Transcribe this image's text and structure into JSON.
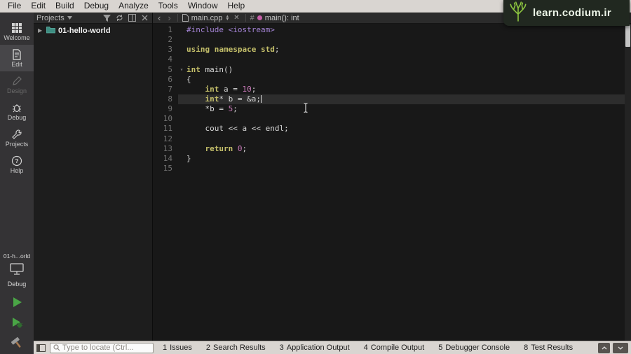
{
  "menu_bar": {
    "items": [
      "File",
      "Edit",
      "Build",
      "Debug",
      "Analyze",
      "Tools",
      "Window",
      "Help"
    ]
  },
  "watermark": {
    "text": "learn.codium.ir"
  },
  "mode_sidebar": {
    "items": [
      {
        "label": "Welcome"
      },
      {
        "label": "Edit",
        "active": true
      },
      {
        "label": "Design",
        "disabled": true
      },
      {
        "label": "Debug"
      },
      {
        "label": "Projects"
      },
      {
        "label": "Help"
      }
    ],
    "kit": {
      "project": "01-h...orld",
      "config": "Debug"
    }
  },
  "projects_panel": {
    "title": "Projects",
    "tree": [
      {
        "label": "01-hello-world"
      }
    ]
  },
  "editor": {
    "toolbar": {
      "filename": "main.cpp",
      "hash": "#",
      "symbol": "main(): int"
    },
    "code_lines": [
      {
        "n": 1,
        "t": [
          [
            "pp",
            "#include <iostream>"
          ]
        ]
      },
      {
        "n": 2,
        "t": []
      },
      {
        "n": 3,
        "t": [
          [
            "kw",
            "using"
          ],
          [
            "pl",
            " "
          ],
          [
            "kw",
            "namespace"
          ],
          [
            "pl",
            " "
          ],
          [
            "kw",
            "std"
          ],
          [
            "pl",
            ";"
          ]
        ]
      },
      {
        "n": 4,
        "t": []
      },
      {
        "n": 5,
        "t": [
          [
            "kw",
            "int"
          ],
          [
            "pl",
            " main()"
          ]
        ],
        "fold": true
      },
      {
        "n": 6,
        "t": [
          [
            "pl",
            "{"
          ]
        ]
      },
      {
        "n": 7,
        "t": [
          [
            "pl",
            "    "
          ],
          [
            "kw",
            "int"
          ],
          [
            "pl",
            " a = "
          ],
          [
            "num",
            "10"
          ],
          [
            "pl",
            ";"
          ]
        ]
      },
      {
        "n": 8,
        "t": [
          [
            "pl",
            "    "
          ],
          [
            "kw",
            "int"
          ],
          [
            "pl",
            "* b = &a;"
          ]
        ],
        "current": true,
        "caret": true
      },
      {
        "n": 9,
        "t": [
          [
            "pl",
            "    *b = "
          ],
          [
            "num",
            "5"
          ],
          [
            "pl",
            ";"
          ]
        ]
      },
      {
        "n": 10,
        "t": []
      },
      {
        "n": 11,
        "t": [
          [
            "pl",
            "    cout << a << endl;"
          ]
        ]
      },
      {
        "n": 12,
        "t": []
      },
      {
        "n": 13,
        "t": [
          [
            "pl",
            "    "
          ],
          [
            "kw",
            "return"
          ],
          [
            "pl",
            " "
          ],
          [
            "num",
            "0"
          ],
          [
            "pl",
            ";"
          ]
        ]
      },
      {
        "n": 14,
        "t": [
          [
            "pl",
            "}"
          ]
        ]
      },
      {
        "n": 15,
        "t": []
      }
    ]
  },
  "bottom_bar": {
    "locator_placeholder": "Type to locate (Ctrl...",
    "panes": [
      {
        "key": "1",
        "label": "Issues"
      },
      {
        "key": "2",
        "label": "Search Results"
      },
      {
        "key": "3",
        "label": "Application Output"
      },
      {
        "key": "4",
        "label": "Compile Output"
      },
      {
        "key": "5",
        "label": "Debugger Console"
      },
      {
        "key": "8",
        "label": "Test Results"
      }
    ]
  },
  "colors": {
    "c-pp": "#a383d4",
    "c-kw": "#c4bf6a",
    "c-num": "#c678b6",
    "c-pl": "#d6d6d6",
    "c-caret": "#e8e8e8",
    "cur-line": "#2d2d2d",
    "run-green": "#4aa546",
    "logo-green": "#8dc63f"
  }
}
